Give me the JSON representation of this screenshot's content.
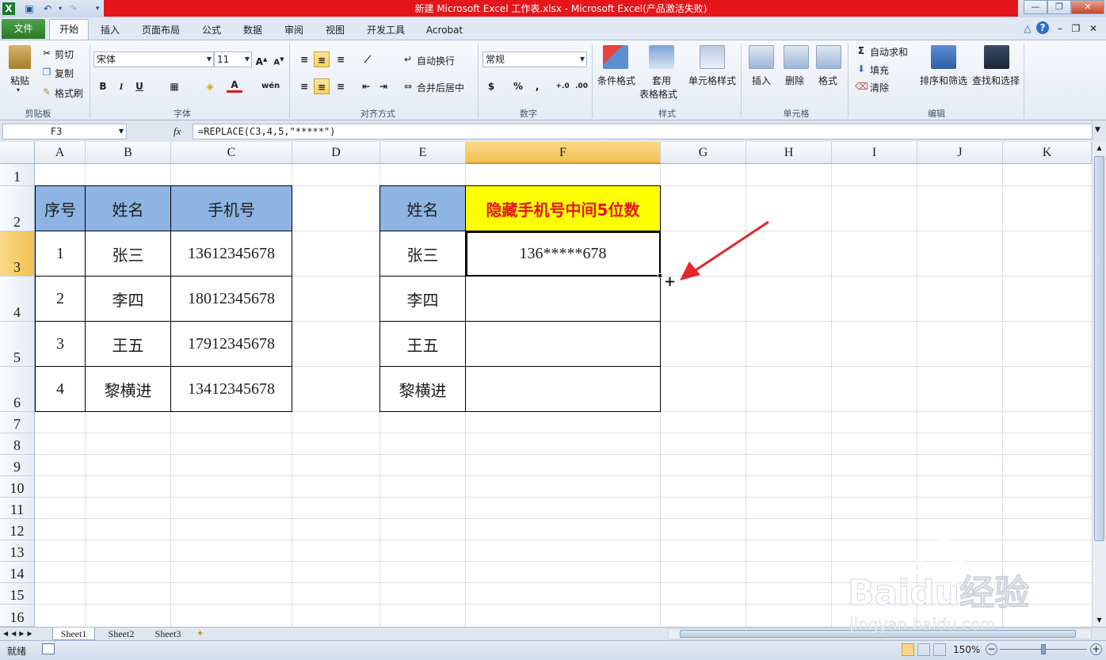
{
  "titlebar": {
    "title": "新建 Microsoft Excel 工作表.xlsx - Microsoft Excel(产品激活失败)"
  },
  "ribbon_tabs": [
    "文件",
    "开始",
    "插入",
    "页面布局",
    "公式",
    "数据",
    "审阅",
    "视图",
    "开发工具",
    "Acrobat"
  ],
  "clipboard": {
    "paste": "粘贴",
    "cut": "剪切",
    "copy": "复制",
    "format_painter": "格式刷",
    "group": "剪贴板"
  },
  "font": {
    "name": "宋体",
    "size": "11",
    "bold": "B",
    "italic": "I",
    "underline": "U",
    "group": "字体"
  },
  "alignment": {
    "wrap": "自动换行",
    "merge": "合并后居中",
    "group": "对齐方式"
  },
  "number": {
    "format": "常规",
    "currency": "$",
    "percent": "%",
    "comma": ",",
    "group": "数字"
  },
  "styles": {
    "conditional": "条件格式",
    "table_line1": "套用",
    "table_line2": "表格格式",
    "cell_styles": "单元格样式",
    "group": "样式"
  },
  "cells": {
    "insert": "插入",
    "delete": "删除",
    "format": "格式",
    "group": "单元格"
  },
  "editing": {
    "autosum": "自动求和",
    "fill": "填充",
    "clear": "清除",
    "sort": "排序和筛选",
    "find": "查找和选择",
    "group": "编辑"
  },
  "formula_bar": {
    "name_box": "F3",
    "fx": "fx",
    "formula": "=REPLACE(C3,4,5,\"*****\")"
  },
  "columns": [
    "A",
    "B",
    "C",
    "D",
    "E",
    "F",
    "G",
    "H",
    "I",
    "J",
    "K"
  ],
  "rows": [
    "1",
    "2",
    "3",
    "4",
    "5",
    "6",
    "7",
    "8",
    "9",
    "10",
    "11",
    "12",
    "13",
    "14",
    "15",
    "16"
  ],
  "table1": {
    "headers": [
      "序号",
      "姓名",
      "手机号"
    ],
    "rows": [
      [
        "1",
        "张三",
        "13612345678"
      ],
      [
        "2",
        "李四",
        "18012345678"
      ],
      [
        "3",
        "王五",
        "17912345678"
      ],
      [
        "4",
        "黎横进",
        "13412345678"
      ]
    ]
  },
  "table2": {
    "headers": [
      "姓名",
      "隐藏手机号中间5位数"
    ],
    "rows": [
      [
        "张三",
        "136*****678"
      ],
      [
        "李四",
        ""
      ],
      [
        "王五",
        ""
      ],
      [
        "黎横进",
        ""
      ]
    ]
  },
  "sheets": [
    "Sheet1",
    "Sheet2",
    "Sheet3"
  ],
  "status": {
    "ready": "就绪",
    "zoom": "150%"
  },
  "watermark": {
    "brand": "Baidu经验",
    "url": "jingyan.baidu.com"
  },
  "colors": {
    "title_red": "#e5161b",
    "header_blue": "#8db4e2",
    "highlight_yellow": "#ffff00",
    "accent_red": "#e4161b"
  }
}
